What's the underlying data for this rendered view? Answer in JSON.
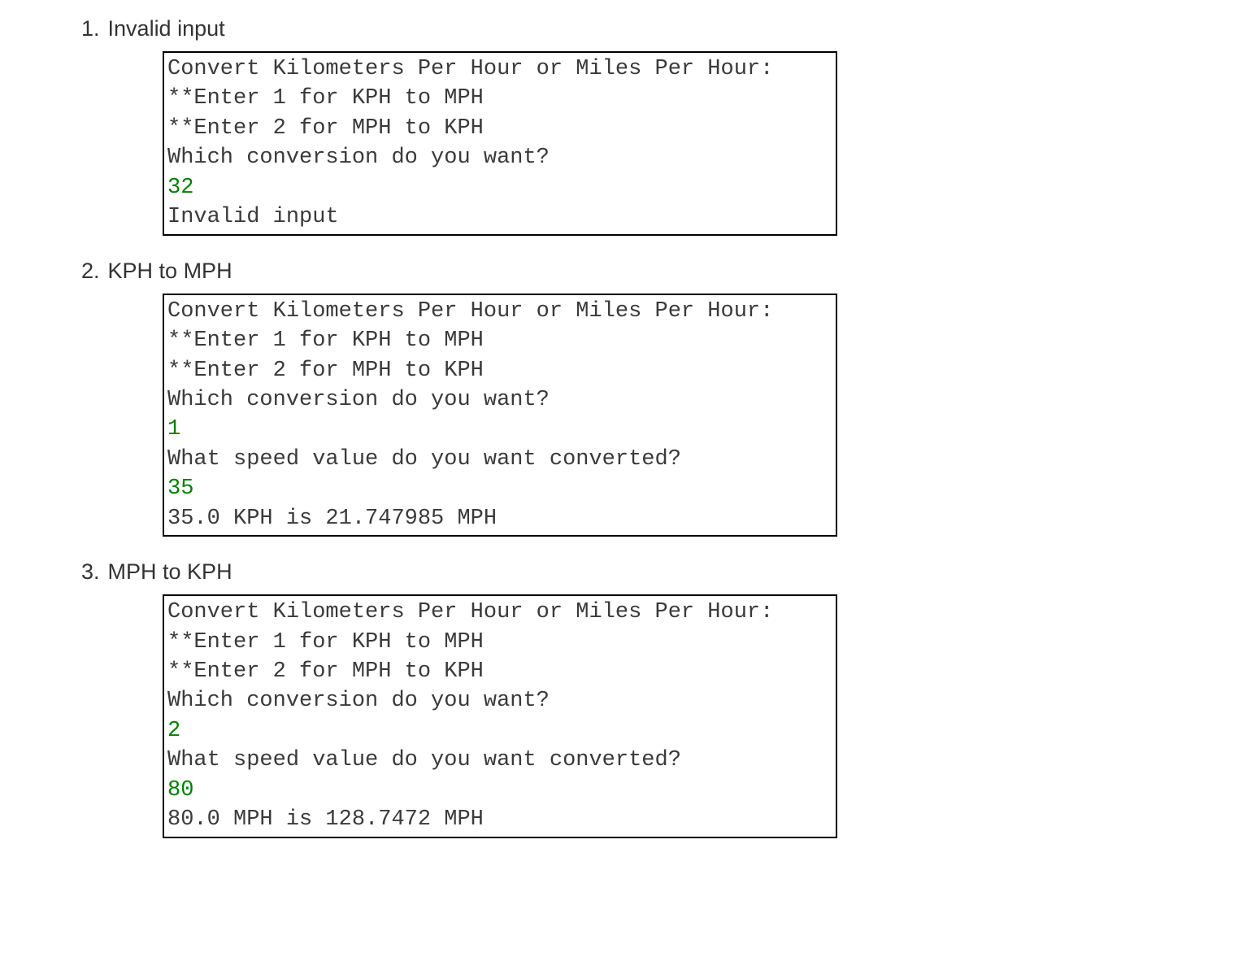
{
  "sections": [
    {
      "number": "1.",
      "title": "Invalid input",
      "lines": [
        {
          "text": "Convert Kilometers Per Hour or Miles Per Hour:",
          "input": false
        },
        {
          "text": "**Enter 1 for KPH to MPH",
          "input": false
        },
        {
          "text": "**Enter 2 for MPH to KPH",
          "input": false
        },
        {
          "text": "Which conversion do you want?",
          "input": false
        },
        {
          "text": "32",
          "input": true
        },
        {
          "text": "Invalid input",
          "input": false
        }
      ]
    },
    {
      "number": "2.",
      "title": "KPH to MPH",
      "lines": [
        {
          "text": "Convert Kilometers Per Hour or Miles Per Hour:",
          "input": false
        },
        {
          "text": "**Enter 1 for KPH to MPH",
          "input": false
        },
        {
          "text": "**Enter 2 for MPH to KPH",
          "input": false
        },
        {
          "text": "Which conversion do you want?",
          "input": false
        },
        {
          "text": "1",
          "input": true
        },
        {
          "text": "What speed value do you want converted?",
          "input": false
        },
        {
          "text": "35",
          "input": true
        },
        {
          "text": "35.0 KPH is 21.747985 MPH",
          "input": false
        }
      ]
    },
    {
      "number": "3.",
      "title": "MPH to KPH",
      "lines": [
        {
          "text": "Convert Kilometers Per Hour or Miles Per Hour:",
          "input": false
        },
        {
          "text": "**Enter 1 for KPH to MPH",
          "input": false
        },
        {
          "text": "**Enter 2 for MPH to KPH",
          "input": false
        },
        {
          "text": "Which conversion do you want?",
          "input": false
        },
        {
          "text": "2",
          "input": true
        },
        {
          "text": "What speed value do you want converted?",
          "input": false
        },
        {
          "text": "80",
          "input": true
        },
        {
          "text": "80.0 MPH is 128.7472 MPH",
          "input": false
        }
      ]
    }
  ]
}
